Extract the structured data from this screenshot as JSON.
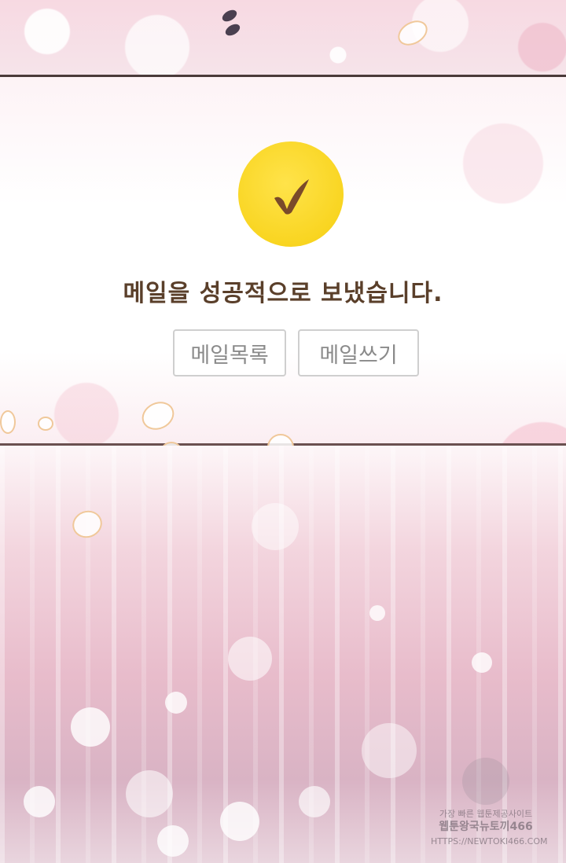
{
  "dialog": {
    "message": "메일을 성공적으로 보냈습니다.",
    "buttons": {
      "mail_list": "메일목록",
      "mail_write": "메일쓰기"
    },
    "check_color": "#f6cf10",
    "check_mark_color": "#7a4a2a"
  },
  "watermark": {
    "line1": "가장 빠른 웹툰제공사이트",
    "line2": "웹툰왕국뉴토끼466",
    "line3": "HTTPS://NEWTOKI466.COM"
  }
}
